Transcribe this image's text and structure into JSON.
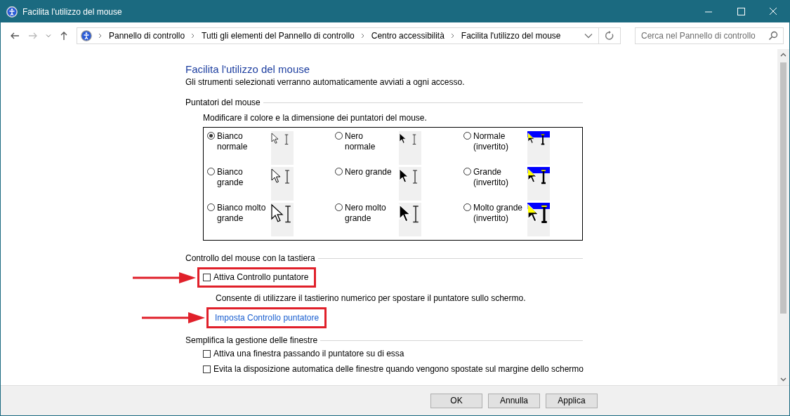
{
  "window": {
    "title": "Facilita l'utilizzo del mouse"
  },
  "breadcrumb": [
    "Pannello di controllo",
    "Tutti gli elementi del Pannello di controllo",
    "Centro accessibilità",
    "Facilita l'utilizzo del mouse"
  ],
  "search": {
    "placeholder": "Cerca nel Pannello di controllo"
  },
  "page": {
    "title": "Facilita l'utilizzo del mouse",
    "subtitle": "Gli strumenti selezionati verranno automaticamente avviati a ogni accesso."
  },
  "pointers": {
    "heading": "Puntatori del mouse",
    "description": "Modificare il colore e la dimensione dei puntatori del mouse.",
    "options": [
      {
        "label": "Bianco normale",
        "selected": true,
        "kind": "white"
      },
      {
        "label": "Nero normale",
        "selected": false,
        "kind": "black"
      },
      {
        "label": "Normale (invertito)",
        "selected": false,
        "kind": "inverted"
      },
      {
        "label": "Bianco grande",
        "selected": false,
        "kind": "white"
      },
      {
        "label": "Nero grande",
        "selected": false,
        "kind": "black"
      },
      {
        "label": "Grande (invertito)",
        "selected": false,
        "kind": "inverted"
      },
      {
        "label": "Bianco molto grande",
        "selected": false,
        "kind": "white"
      },
      {
        "label": "Nero molto grande",
        "selected": false,
        "kind": "black"
      },
      {
        "label": "Molto grande (invertito)",
        "selected": false,
        "kind": "inverted"
      }
    ]
  },
  "keyboard": {
    "heading": "Controllo del mouse con la tastiera",
    "checkbox": {
      "label": "Attiva Controllo puntatore",
      "checked": false,
      "annotated": true
    },
    "description": "Consente di utilizzare il tastierino numerico per spostare il puntatore sullo schermo.",
    "link": {
      "label": "Imposta Controllo puntatore",
      "annotated": true
    }
  },
  "windows": {
    "heading": "Semplifica la gestione delle finestre",
    "checkboxes": [
      {
        "label": "Attiva una finestra passando il puntatore su di essa",
        "checked": false
      },
      {
        "label": "Evita la disposizione automatica delle finestre quando vengono spostate sul margine dello schermo",
        "checked": false
      }
    ]
  },
  "buttons": [
    "OK",
    "Annulla",
    "Applica"
  ]
}
